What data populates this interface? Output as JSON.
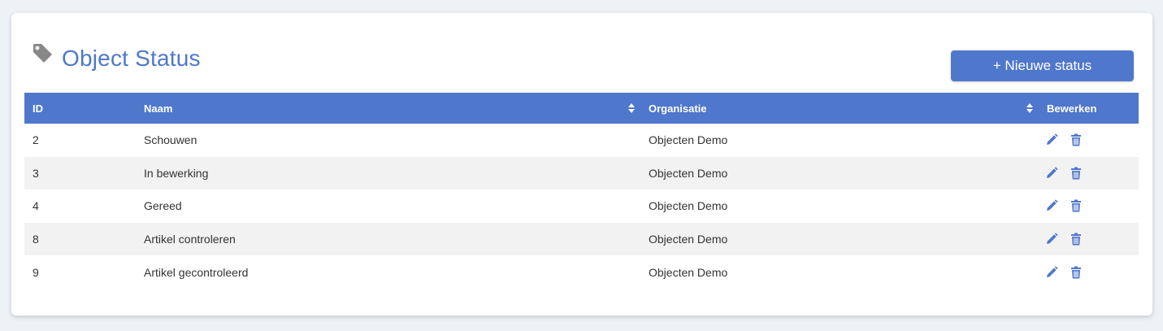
{
  "page": {
    "title": "Object Status",
    "new_button_label": "+ Nieuwe status"
  },
  "colors": {
    "accent": "#4f77cc",
    "row_alt": "#f2f2f2",
    "icon_gray": "#888888"
  },
  "table": {
    "headers": {
      "id": "ID",
      "naam": "Naam",
      "organisatie": "Organisatie",
      "bewerken": "Bewerken"
    },
    "rows": [
      {
        "id": "2",
        "naam": "Schouwen",
        "organisatie": "Objecten Demo"
      },
      {
        "id": "3",
        "naam": "In bewerking",
        "organisatie": "Objecten Demo"
      },
      {
        "id": "4",
        "naam": "Gereed",
        "organisatie": "Objecten Demo"
      },
      {
        "id": "8",
        "naam": "Artikel controleren",
        "organisatie": "Objecten Demo"
      },
      {
        "id": "9",
        "naam": "Artikel gecontroleerd",
        "organisatie": "Objecten Demo"
      }
    ]
  },
  "icons": {
    "title": "tag-icon",
    "sort": "sort-icon",
    "edit": "pencil-icon",
    "delete": "trash-icon"
  }
}
